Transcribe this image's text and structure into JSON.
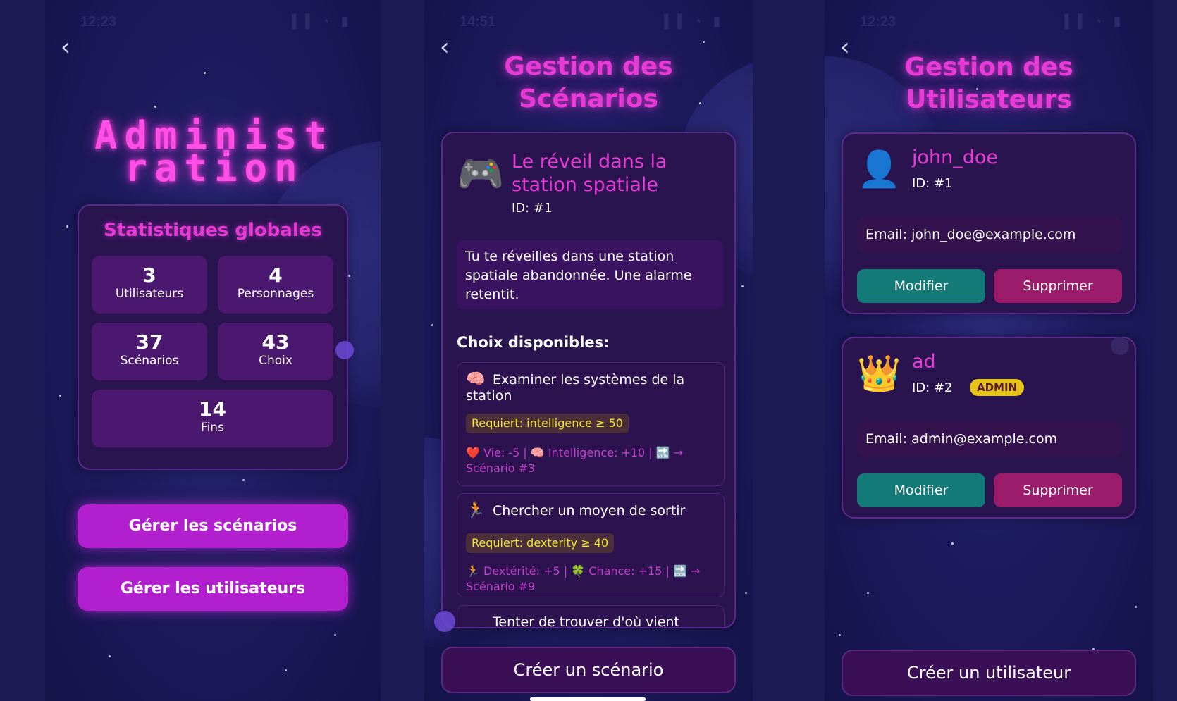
{
  "status": {
    "time1": "12:23",
    "time2": "14:51",
    "time3": "12:23",
    "icons": "▐▐ ◔ ▮"
  },
  "admin": {
    "title": "Administ ration",
    "stats_title": "Statistiques globales",
    "stats": [
      {
        "value": "3",
        "label": "Utilisateurs"
      },
      {
        "value": "4",
        "label": "Personnages"
      },
      {
        "value": "37",
        "label": "Scénarios"
      },
      {
        "value": "43",
        "label": "Choix"
      },
      {
        "value": "14",
        "label": "Fins"
      }
    ],
    "manage_scenarios": "Gérer les scénarios",
    "manage_users": "Gérer les utilisateurs"
  },
  "scenarios": {
    "title": "Gestion des Scénarios",
    "item": {
      "emoji": "🎮",
      "title": "Le réveil dans la station spatiale",
      "id": "ID: #1",
      "description": "Tu te réveilles dans une station spatiale abandonnée. Une alarme retentit."
    },
    "choices_title": "Choix disponibles:",
    "choices": [
      {
        "emoji": "🧠",
        "title": "Examiner les systèmes de la station",
        "requirement": "Requiert: intelligence ≥ 50",
        "effects": "❤️ Vie: -5 | 🧠 Intelligence: +10 | 🔜 → Scénario #3"
      },
      {
        "emoji": "🏃",
        "title": "Chercher un moyen de sortir",
        "requirement": "Requiert: dexterity ≥ 40",
        "effects": "🏃 Dextérité: +5 | 🍀 Chance: +15 | 🔜 → Scénario #9"
      },
      {
        "emoji": "",
        "title": "Tenter de trouver d'où vient",
        "requirement": "",
        "effects": ""
      }
    ],
    "create": "Créer un scénario"
  },
  "users": {
    "title": "Gestion des Utilisateurs",
    "list": [
      {
        "emoji": "👤",
        "name": "john_doe",
        "id": "ID: #1",
        "badge": "",
        "email": "Email: john_doe@example.com",
        "edit": "Modifier",
        "delete": "Supprimer"
      },
      {
        "emoji": "👑",
        "name": "ad",
        "id": "ID: #2",
        "badge": "ADMIN",
        "email": "Email: admin@example.com",
        "edit": "Modifier",
        "delete": "Supprimer"
      }
    ],
    "create": "Créer un utilisateur"
  },
  "colors": {
    "accent": "#e83ad6",
    "button": "#b21fcf",
    "edit": "#137a78",
    "delete": "#9a1c6a",
    "badge": "#e6c418",
    "requirement": "#f2e633"
  }
}
